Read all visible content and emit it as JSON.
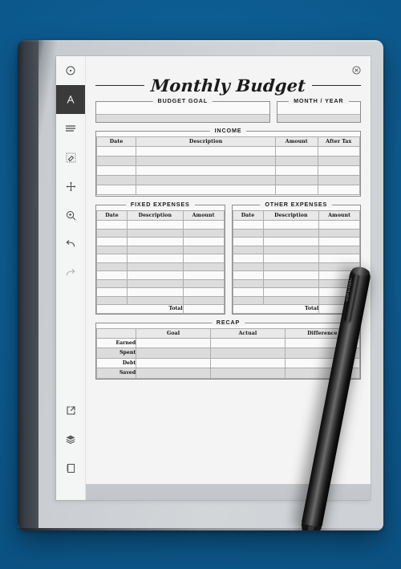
{
  "app": {
    "close_label": "×"
  },
  "toolbar": {
    "items": [
      {
        "name": "pen-tool",
        "icon": "circle-dot-icon",
        "active": false
      },
      {
        "name": "text-tool",
        "icon": "letter-a-icon",
        "active": true
      },
      {
        "name": "layers-tool",
        "icon": "lines-icon",
        "active": false
      },
      {
        "name": "eraser-tool",
        "icon": "eraser-icon",
        "active": false
      },
      {
        "name": "move-tool",
        "icon": "move-arrows-icon",
        "active": false
      },
      {
        "name": "zoom-tool",
        "icon": "magnifier-plus-icon",
        "active": false
      },
      {
        "name": "undo-tool",
        "icon": "undo-arrow-icon",
        "active": false
      },
      {
        "name": "redo-tool",
        "icon": "redo-arrow-icon",
        "active": false
      }
    ],
    "bottom_items": [
      {
        "name": "share-tool",
        "icon": "export-box-arrow-icon"
      },
      {
        "name": "layers-stack",
        "icon": "layers-stack-icon"
      },
      {
        "name": "pages-tool",
        "icon": "notebook-page-icon"
      }
    ]
  },
  "document": {
    "title": "Monthly Budget",
    "fields": {
      "budget_goal": {
        "legend": "BUDGET GOAL",
        "value": "",
        "lines": 2
      },
      "month_year": {
        "legend": "MONTH / YEAR",
        "value": "",
        "lines": 2
      }
    },
    "income": {
      "legend": "INCOME",
      "columns": [
        "Date",
        "Description",
        "Amount",
        "After Tax"
      ],
      "rows": [
        [
          "",
          "",
          "",
          ""
        ],
        [
          "",
          "",
          "",
          ""
        ],
        [
          "",
          "",
          "",
          ""
        ],
        [
          "",
          "",
          "",
          ""
        ],
        [
          "",
          "",
          "",
          ""
        ]
      ]
    },
    "fixed_expenses": {
      "legend": "FIXED EXPENSES",
      "columns": [
        "Date",
        "Description",
        "Amount"
      ],
      "row_count": 10,
      "total_label": "Total",
      "total_value": ""
    },
    "other_expenses": {
      "legend": "OTHER EXPENSES",
      "columns": [
        "Date",
        "Description",
        "Amount"
      ],
      "row_count": 10,
      "total_label": "Total",
      "total_value": ""
    },
    "recap": {
      "legend": "RECAP",
      "columns": [
        "",
        "Goal",
        "Actual",
        "Difference"
      ],
      "rows": [
        {
          "label": "Earned",
          "goal": "",
          "actual": "",
          "difference": ""
        },
        {
          "label": "Spent",
          "goal": "",
          "actual": "",
          "difference": ""
        },
        {
          "label": "Debt",
          "goal": "",
          "actual": "",
          "difference": ""
        },
        {
          "label": "Saved",
          "goal": "",
          "actual": "",
          "difference": ""
        }
      ]
    }
  },
  "stylus": {
    "brand": "reMarkable"
  },
  "colors": {
    "background": "#0d5c92",
    "device_body": "#ced2d6",
    "bezel_dark": "#363c43",
    "page": "#f4f4f4",
    "row_shaded": "#dcdcdc",
    "row_plain": "#fafafa",
    "rule": "#8d8d8d",
    "active_tool": "#3a3a3a"
  }
}
